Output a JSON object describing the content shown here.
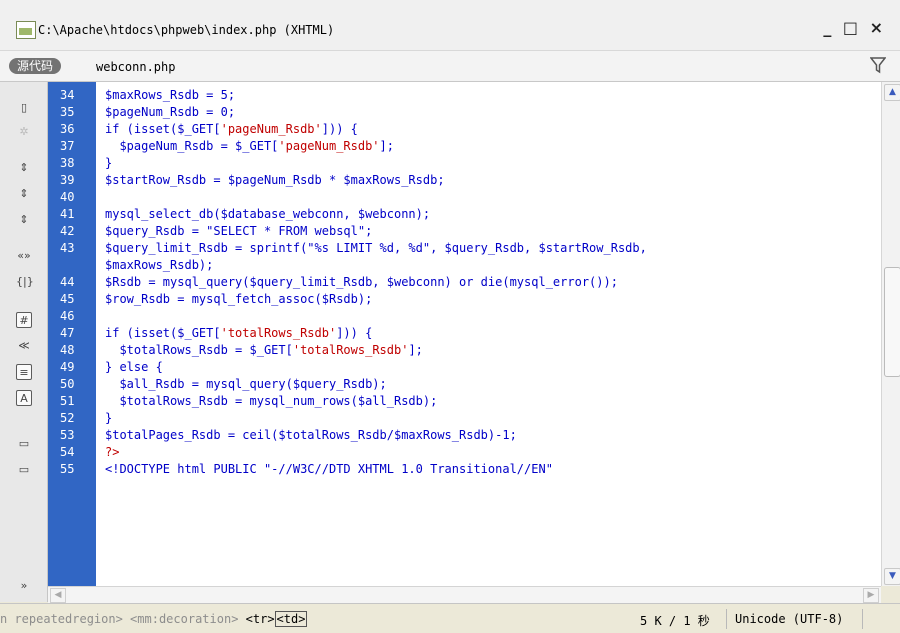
{
  "window": {
    "title": "C:\\Apache\\htdocs\\phpweb\\index.php (XHTML)",
    "controls": "_ □ ×"
  },
  "tabbar": {
    "source_button": "源代码",
    "file": "webconn.php"
  },
  "code": [
    {
      "n": "34",
      "text": "$maxRows_Rsdb = 5;"
    },
    {
      "n": "35",
      "text": "$pageNum_Rsdb = 0;"
    },
    {
      "n": "36",
      "text": "if (isset($_GET['pageNum_Rsdb'])) {"
    },
    {
      "n": "37",
      "text": "  $pageNum_Rsdb = $_GET['pageNum_Rsdb'];"
    },
    {
      "n": "38",
      "text": "}"
    },
    {
      "n": "39",
      "text": "$startRow_Rsdb = $pageNum_Rsdb * $maxRows_Rsdb;"
    },
    {
      "n": "40",
      "text": ""
    },
    {
      "n": "41",
      "text": "mysql_select_db($database_webconn, $webconn);"
    },
    {
      "n": "42",
      "text": "$query_Rsdb = \"SELECT * FROM websql\";"
    },
    {
      "n": "43",
      "text": "$query_limit_Rsdb = sprintf(\"%s LIMIT %d, %d\", $query_Rsdb, $startRow_Rsdb,"
    },
    {
      "n": "",
      "text": "$maxRows_Rsdb);"
    },
    {
      "n": "44",
      "text": "$Rsdb = mysql_query($query_limit_Rsdb, $webconn) or die(mysql_error());"
    },
    {
      "n": "45",
      "text": "$row_Rsdb = mysql_fetch_assoc($Rsdb);"
    },
    {
      "n": "46",
      "text": ""
    },
    {
      "n": "47",
      "text": "if (isset($_GET['totalRows_Rsdb'])) {"
    },
    {
      "n": "48",
      "text": "  $totalRows_Rsdb = $_GET['totalRows_Rsdb'];"
    },
    {
      "n": "49",
      "text": "} else {"
    },
    {
      "n": "50",
      "text": "  $all_Rsdb = mysql_query($query_Rsdb);"
    },
    {
      "n": "51",
      "text": "  $totalRows_Rsdb = mysql_num_rows($all_Rsdb);"
    },
    {
      "n": "52",
      "text": "}"
    },
    {
      "n": "53",
      "text": "$totalPages_Rsdb = ceil($totalRows_Rsdb/$maxRows_Rsdb)-1;"
    },
    {
      "n": "54",
      "text": "?>"
    },
    {
      "n": "55",
      "text": "<!DOCTYPE html PUBLIC \"-//W3C//DTD XHTML 1.0 Transitional//EN\""
    }
  ],
  "statusbar": {
    "crumb_prefix": "n repeatedregion> <mm:decoration> ",
    "crumb_current": "<tr>",
    "crumb_selected": "<td>",
    "size": "5 K / 1 秒",
    "encoding": "Unicode (UTF-8)"
  },
  "colors": {
    "gutter": "#3166c4",
    "code_text": "#0000c8",
    "string_text": "#c00000"
  }
}
